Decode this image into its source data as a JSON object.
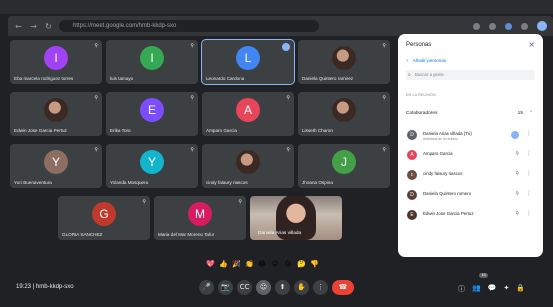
{
  "browser": {
    "url": "https://meet.google.com/hmb-kkdp-sxo"
  },
  "meeting": {
    "time": "19:23",
    "code": "hmb-kkdp-sxo"
  },
  "participants_grid": [
    {
      "name": "Eba marcela rodriguez torres",
      "initial": "I",
      "color": "#a142f4"
    },
    {
      "name": "luis tamayo",
      "initial": "I",
      "color": "#34a853"
    },
    {
      "name": "Leonardo Cardona",
      "initial": "L",
      "color": "#4285f4",
      "active": true
    },
    {
      "name": "Daniela Quintero ramirez",
      "photo": true
    },
    {
      "name": "Edwin Jose Garcia Pertuz",
      "photo": true
    },
    {
      "name": "Erika Toro",
      "initial": "E",
      "color": "#7c4dff"
    },
    {
      "name": "Amparo Garcia",
      "initial": "A",
      "color": "#e8455a"
    },
    {
      "name": "Lisseth Charon",
      "photo": true
    },
    {
      "name": "Yuri Buenaventura",
      "initial": "Y",
      "color": "#8d6e63"
    },
    {
      "name": "Yolanda Mosquera",
      "initial": "Y",
      "color": "#12b5cb"
    },
    {
      "name": "cindy falaury riascos",
      "photo": true
    },
    {
      "name": "Jhoana Ospina",
      "initial": "J",
      "color": "#43a047"
    },
    {
      "name": "GLORIA SANCHEZ",
      "initial": "G",
      "color": "#c0392b"
    },
    {
      "name": "Maria del Mar Moreno Tafur",
      "initial": "M",
      "color": "#d81b60"
    }
  ],
  "camera_tile": {
    "name": "Daniela Arias villada"
  },
  "reactions": [
    "💖",
    "👍",
    "🎉",
    "👏",
    "😂",
    "😮",
    "😢",
    "🤔",
    "👎"
  ],
  "controls": {
    "mic": "🎤",
    "camera": "📷",
    "captions": "CC",
    "present": "⬆",
    "raise_hand": "✋",
    "more": "⋮",
    "end": "☎"
  },
  "right_controls": {
    "info": "ⓘ",
    "people": "👥",
    "chat": "💬",
    "activities": "✦",
    "lock": "🔒",
    "people_badge": "15"
  },
  "people_panel": {
    "title": "Personas",
    "add_label": "Añadir personas",
    "search_placeholder": "Buscar a gente",
    "section_label": "EN LA REUNIÓN",
    "collaborators_label": "Colaboradores",
    "collaborators_count": "15",
    "list": [
      {
        "name": "Daniela Arias villada (Tú)",
        "sub": "Anfitriona de la reunión",
        "initial": "D",
        "color": "#5f6368",
        "live": true
      },
      {
        "name": "Amparo Garcia",
        "sub": "",
        "initial": "A",
        "color": "#e8455a",
        "live": false
      },
      {
        "name": "cindy faisury riascos",
        "sub": "",
        "initial": "c",
        "color": "#6d4c41",
        "live": false
      },
      {
        "name": "Daniela Quintero romero",
        "sub": "",
        "initial": "D",
        "color": "#5d4037",
        "live": false
      },
      {
        "name": "Edwin Jose Garcia Pertuz",
        "sub": "",
        "initial": "E",
        "color": "#4e342e",
        "live": false
      }
    ]
  }
}
